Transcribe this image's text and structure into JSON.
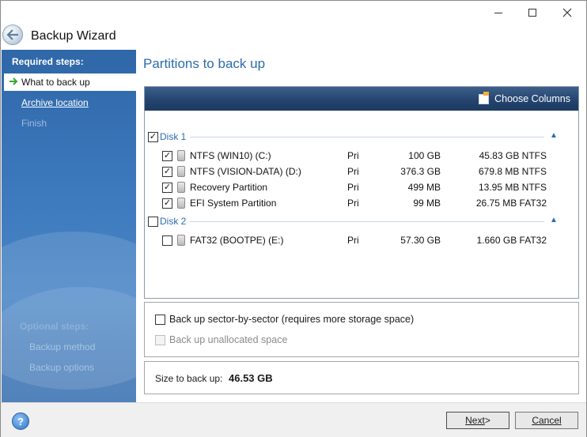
{
  "window": {
    "title": "Backup Wizard"
  },
  "sidebar": {
    "required_heading": "Required steps:",
    "steps": [
      {
        "label": "What to back up",
        "state": "active"
      },
      {
        "label": "Archive location",
        "state": "link"
      },
      {
        "label": "Finish",
        "state": "disabled"
      }
    ],
    "optional_heading": "Optional steps:",
    "optional_steps": [
      "Backup method",
      "Backup options"
    ]
  },
  "main": {
    "page_title": "Partitions to back up",
    "choose_columns": "Choose Columns",
    "disks": [
      {
        "label": "Disk 1",
        "checked": true,
        "partitions": [
          {
            "name": "NTFS (WIN10) (C:)",
            "type": "Pri",
            "capacity": "100 GB",
            "free": "45.83 GB NTFS",
            "checked": true
          },
          {
            "name": "NTFS (VISION-DATA) (D:)",
            "type": "Pri",
            "capacity": "376.3 GB",
            "free": "679.8 MB NTFS",
            "checked": true
          },
          {
            "name": "Recovery Partition",
            "type": "Pri",
            "capacity": "499 MB",
            "free": "13.95 MB NTFS",
            "checked": true
          },
          {
            "name": "EFI System Partition",
            "type": "Pri",
            "capacity": "99 MB",
            "free": "26.75 MB FAT32",
            "checked": true
          }
        ]
      },
      {
        "label": "Disk 2",
        "checked": false,
        "partitions": [
          {
            "name": "FAT32 (BOOTPE) (E:)",
            "type": "Pri",
            "capacity": "57.30 GB",
            "free": "1.660 GB FAT32",
            "checked": false
          }
        ]
      }
    ],
    "options": {
      "sector_by_sector": "Back up sector-by-sector (requires more storage space)",
      "sector_by_sector_checked": false,
      "unallocated": "Back up unallocated space",
      "unallocated_enabled": false
    },
    "size": {
      "label": "Size to back up:",
      "value": "46.53 GB"
    }
  },
  "footer": {
    "help": "?",
    "next_label": "Next",
    "next_suffix": " >",
    "cancel_label": "Cancel"
  },
  "colors": {
    "accent": "#2c6bb0",
    "sidebar": "#3c79bd",
    "grid_header": "#24456f"
  }
}
